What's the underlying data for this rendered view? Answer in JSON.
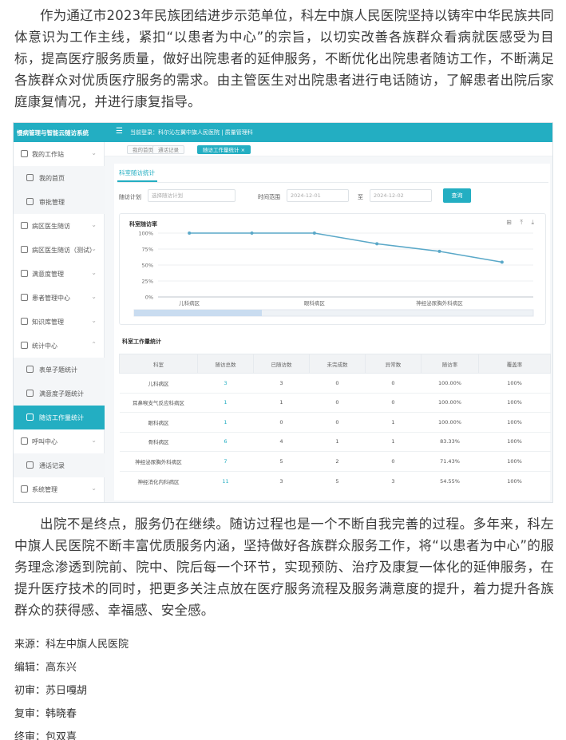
{
  "article": {
    "para1": "作为通辽市2023年民族团结进步示范单位，科左中旗人民医院坚持以铸牢中华民族共同体意识为工作主线，紧扣“以患者为中心”的宗旨，以切实改善各族群众看病就医感受为目标，提高医疗服务质量，做好出院患者的延伸服务，不断优化出院患者随访工作，不断满足各族群众对优质医疗服务的需求。由主管医生对出院患者进行电话随访，了解患者出院后家庭康复情况，并进行康复指导。",
    "para2": "出院不是终点，服务仍在继续。随访过程也是一个不断自我完善的过程。多年来，科左中旗人民医院不断丰富优质服务内涵，坚持做好各族群众服务工作，将“以患者为中心”的服务理念渗透到院前、院中、院后每一个环节，实现预防、治疗及康复一体化的延伸服务，在提升医疗技术的同时，把更多关注点放在医疗服务流程及服务满意度的提升，着力提升各族群众的获得感、幸福感、安全感。",
    "meta": [
      {
        "label": "来源：",
        "value": "科左中旗人民医院"
      },
      {
        "label": "编辑：",
        "value": "高东兴"
      },
      {
        "label": "初审：",
        "value": "苏日嘎胡"
      },
      {
        "label": "复审：",
        "value": "韩晓春"
      },
      {
        "label": "终审：",
        "value": "包双喜"
      }
    ]
  },
  "screenshot": {
    "brand": "慢病管理与智能云随访系统",
    "menu_icon": "☰",
    "user_info": "当前登录：科尔沁左翼中旗人民医院 | 质量管理科",
    "accent": "#23aec2",
    "sidebar": [
      {
        "label": "我的工作站",
        "icon": "monitor-icon",
        "chev": "⌄",
        "type": "group"
      },
      {
        "label": "我的首页",
        "icon": "home-icon",
        "type": "sub"
      },
      {
        "label": "审批管理",
        "icon": "approve-icon",
        "type": "sub"
      },
      {
        "label": "病区医生随访",
        "icon": "ward-icon",
        "chev": "⌄",
        "type": "group"
      },
      {
        "label": "病区医生随访（测试）",
        "icon": "ward-test-icon",
        "chev": "⌄",
        "type": "group"
      },
      {
        "label": "满意度管理",
        "icon": "star-icon",
        "chev": "⌄",
        "type": "group"
      },
      {
        "label": "患者管理中心",
        "icon": "patient-icon",
        "chev": "⌄",
        "type": "group"
      },
      {
        "label": "知识库管理",
        "icon": "book-icon",
        "chev": "⌄",
        "type": "group"
      },
      {
        "label": "统计中心",
        "icon": "stats-icon",
        "chev": "⌃",
        "type": "group"
      },
      {
        "label": "表单子题统计",
        "icon": "form-icon",
        "type": "sub"
      },
      {
        "label": "满意度子题统计",
        "icon": "smile-icon",
        "type": "sub"
      },
      {
        "label": "随访工作量统计",
        "icon": "workload-icon",
        "type": "active"
      },
      {
        "label": "呼叫中心",
        "icon": "phone-icon",
        "chev": "⌄",
        "type": "group"
      },
      {
        "label": "通话记录",
        "icon": "record-icon",
        "type": "sub"
      },
      {
        "label": "系统管理",
        "icon": "gear-icon",
        "chev": "⌄",
        "type": "group"
      }
    ],
    "tabs": [
      {
        "label": "我的首页",
        "on": false
      },
      {
        "label": "通话记录",
        "on": false
      },
      {
        "label": "随访工作量统计 ×",
        "on": true
      }
    ],
    "panel_tab": "科室随访统计",
    "filters": {
      "plan_label": "随访计划",
      "plan_placeholder": "选择随访计划",
      "range_label": "时间范围",
      "start_date": "2024-12-01",
      "sep": "至",
      "end_date": "2024-12-02",
      "query_label": "查询"
    },
    "chart_title": "科室随访率",
    "chart_tools": "⊞ ⤒ ⤓",
    "table_title": "科室工作量统计",
    "table": {
      "headers": [
        "科室",
        "随访总数",
        "已随访数",
        "未完成数",
        "异常数",
        "随访率",
        "覆盖率"
      ],
      "rows": [
        [
          "儿科病区",
          "3",
          "3",
          "0",
          "0",
          "100.00%",
          "100%"
        ],
        [
          "耳鼻喉支气反应科病区",
          "1",
          "1",
          "0",
          "0",
          "100.00%",
          "100%"
        ],
        [
          "眼科病区",
          "1",
          "0",
          "0",
          "1",
          "100.00%",
          "100%"
        ],
        [
          "骨科病区",
          "6",
          "4",
          "1",
          "1",
          "83.33%",
          "100%"
        ],
        [
          "神经泌尿胸外科病区",
          "7",
          "5",
          "2",
          "0",
          "71.43%",
          "100%"
        ],
        [
          "神经消化内科病区",
          "11",
          "3",
          "5",
          "3",
          "54.55%",
          "100%"
        ]
      ]
    }
  },
  "chart_data": {
    "type": "line",
    "title": "科室随访率",
    "x": [
      "儿科病区",
      "耳鼻喉支气反应科病区",
      "眼科病区",
      "骨科病区",
      "神经泌尿胸外科病区",
      "神经消化内科病区"
    ],
    "x_tick_labels": [
      "儿科病区",
      "",
      "眼科病区",
      "",
      "神经泌尿胸外科病区",
      ""
    ],
    "series": [
      {
        "values": [
          100,
          100,
          100,
          83.33,
          71.43,
          54.55
        ]
      }
    ],
    "yticks": [
      "100%",
      "75%",
      "50%",
      "25%",
      "0%"
    ],
    "ylim": [
      0,
      100
    ],
    "grid": true,
    "line_color": "#5aa8c8"
  }
}
